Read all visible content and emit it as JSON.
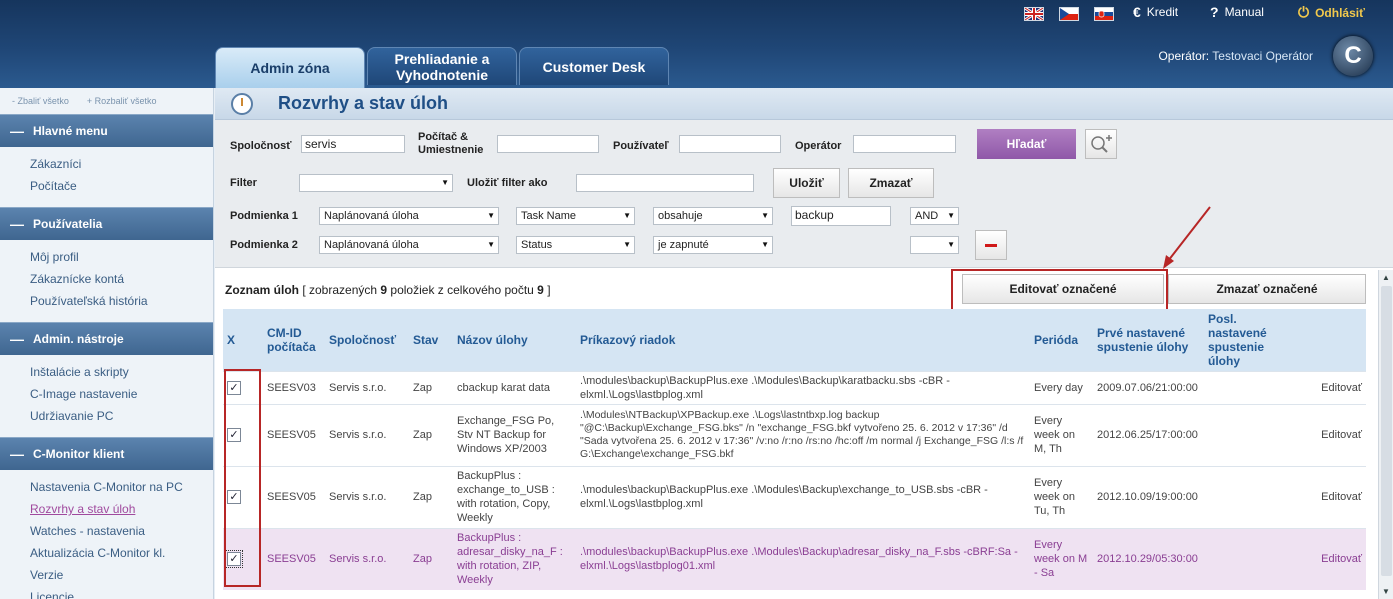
{
  "topbar": {
    "credit": "Kredit",
    "credit_icon": "euro-icon",
    "manual": "Manual",
    "manual_icon": "help-icon",
    "logout": "Odhlásiť",
    "logout_icon": "power-icon",
    "operator_label": "Operátor:",
    "operator_name": "Testovaci Operátor"
  },
  "tabs": [
    {
      "label": "Admin zóna"
    },
    {
      "label": "Prehliadanie a Vyhodnotenie"
    },
    {
      "label": "Customer Desk"
    }
  ],
  "sidebar": {
    "collapse_all": "- Zbaliť všetko",
    "expand_all": "+ Rozbaliť všetko",
    "sections": [
      {
        "title": "Hlavné menu",
        "items": [
          "Zákazníci",
          "Počítače"
        ]
      },
      {
        "title": "Používatelia",
        "items": [
          "Môj profil",
          "Zákaznícke kontá",
          "Používateľská história"
        ]
      },
      {
        "title": "Admin. nástroje",
        "items": [
          "Inštalácie a skripty",
          "C-Image nastavenie",
          "Udržiavanie PC"
        ]
      },
      {
        "title": "C-Monitor klient",
        "items": [
          "Nastavenia C-Monitor na PC",
          "Rozvrhy a stav úloh",
          "Watches - nastavenia",
          "Aktualizácia C-Monitor kl.",
          "Verzie",
          "Licencie"
        ]
      }
    ]
  },
  "page": {
    "title": "Rozvrhy a stav úloh"
  },
  "filters": {
    "company_label": "Spoločnosť",
    "company_value": "servis",
    "computer_label": "Počítač & Umiestnenie",
    "computer_value": "",
    "user_label": "Používateľ",
    "user_value": "",
    "operator_label": "Operátor",
    "operator_value": "",
    "search_button": "Hľadať",
    "filter_label": "Filter",
    "filter_value": "",
    "save_filter_label": "Uložiť filter ako",
    "save_filter_value": "",
    "save_button": "Uložiť",
    "delete_button": "Zmazať",
    "cond1_label": "Podmienka 1",
    "cond1_field": "Naplánovaná úloha",
    "cond1_attr": "Task Name",
    "cond1_op": "obsahuje",
    "cond1_value": "backup",
    "cond1_join": "AND",
    "cond2_label": "Podmienka 2",
    "cond2_field": "Naplánovaná úloha",
    "cond2_attr": "Status",
    "cond2_op": "je zapnuté",
    "cond2_join": ""
  },
  "list": {
    "title": "Zoznam úloh",
    "info_pre": "[ zobrazených ",
    "shown": "9",
    "info_mid": " položiek z celkového počtu ",
    "total": "9",
    "info_post": " ]",
    "edit_selected": "Editovať označené",
    "delete_selected": "Zmazať označené"
  },
  "table": {
    "headers": [
      "X",
      "CM-ID počítača",
      "Spoločnosť",
      "Stav",
      "Názov úlohy",
      "Príkazový riadok",
      "Perióda",
      "Prvé nastavené spustenie úlohy",
      "Posl. nastavené spustenie úlohy",
      ""
    ],
    "rows": [
      {
        "id": "SEESV03",
        "company": "Servis s.r.o.",
        "state": "Zap",
        "name": "cbackup karat data",
        "cmd": ".\\modules\\backup\\BackupPlus.exe .\\Modules\\Backup\\karatbacku.sbs -cBR -elxml.\\Logs\\lastbplog.xml",
        "period": "Every day",
        "first": "2009.07.06/21:00:00",
        "last": "",
        "action": "Editovať",
        "checked": "✓"
      },
      {
        "id": "SEESV05",
        "company": "Servis s.r.o.",
        "state": "Zap",
        "name": "Exchange_FSG Po, Stv NT Backup for Windows XP/2003",
        "cmd": ".\\Modules\\NTBackup\\XPBackup.exe .\\Logs\\lastntbxp.log backup \"@C:\\Backup\\Exchange_FSG.bks\" /n \"exchange_FSG.bkf vytvořeno 25. 6. 2012 v 17:36\" /d \"Sada vytvořena 25. 6. 2012 v 17:36\" /v:no /r:no /rs:no /hc:off /m normal /j Exchange_FSG /l:s /f G:\\Exchange\\exchange_FSG.bkf",
        "period": "Every week on M, Th",
        "first": "2012.06.25/17:00:00",
        "last": "",
        "action": "Editovať",
        "checked": "✓"
      },
      {
        "id": "SEESV05",
        "company": "Servis s.r.o.",
        "state": "Zap",
        "name": "BackupPlus : exchange_to_USB : with rotation, Copy, Weekly",
        "cmd": ".\\modules\\backup\\BackupPlus.exe .\\Modules\\Backup\\exchange_to_USB.sbs -cBR -elxml.\\Logs\\lastbplog.xml",
        "period": "Every week on Tu, Th",
        "first": "2012.10.09/19:00:00",
        "last": "",
        "action": "Editovať",
        "checked": "✓"
      },
      {
        "id": "SEESV05",
        "company": "Servis s.r.o.",
        "state": "Zap",
        "name": "BackupPlus : adresar_disky_na_F : with rotation, ZIP, Weekly",
        "cmd": ".\\modules\\backup\\BackupPlus.exe .\\Modules\\Backup\\adresar_disky_na_F.sbs -cBRF:Sa -elxml.\\Logs\\lastbplog01.xml",
        "period": "Every week on M - Sa",
        "first": "2012.10.29/05:30:00",
        "last": "",
        "action": "Editovať",
        "checked": "✓"
      }
    ]
  }
}
